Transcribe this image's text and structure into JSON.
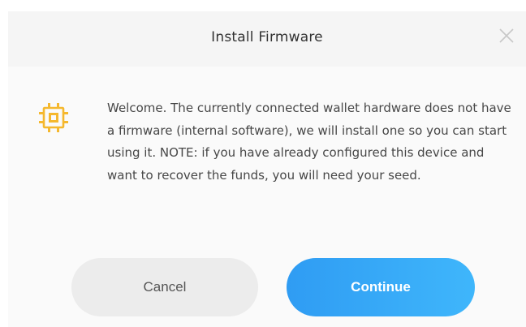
{
  "dialog": {
    "title": "Install Firmware",
    "close_icon": "close-icon",
    "message_icon": "chip-icon",
    "message": "Welcome. The currently connected wallet hardware does not have a firmware (internal software), we will install one so you can start using it. NOTE: if you have already configured this device and want to recover the funds, you will need your seed.",
    "cancel_label": "Cancel",
    "continue_label": "Continue"
  },
  "colors": {
    "chip_icon": "#f5b82e",
    "continue_gradient_start": "#2f9cf3",
    "continue_gradient_end": "#3fb6fb",
    "cancel_background": "#ececec"
  }
}
